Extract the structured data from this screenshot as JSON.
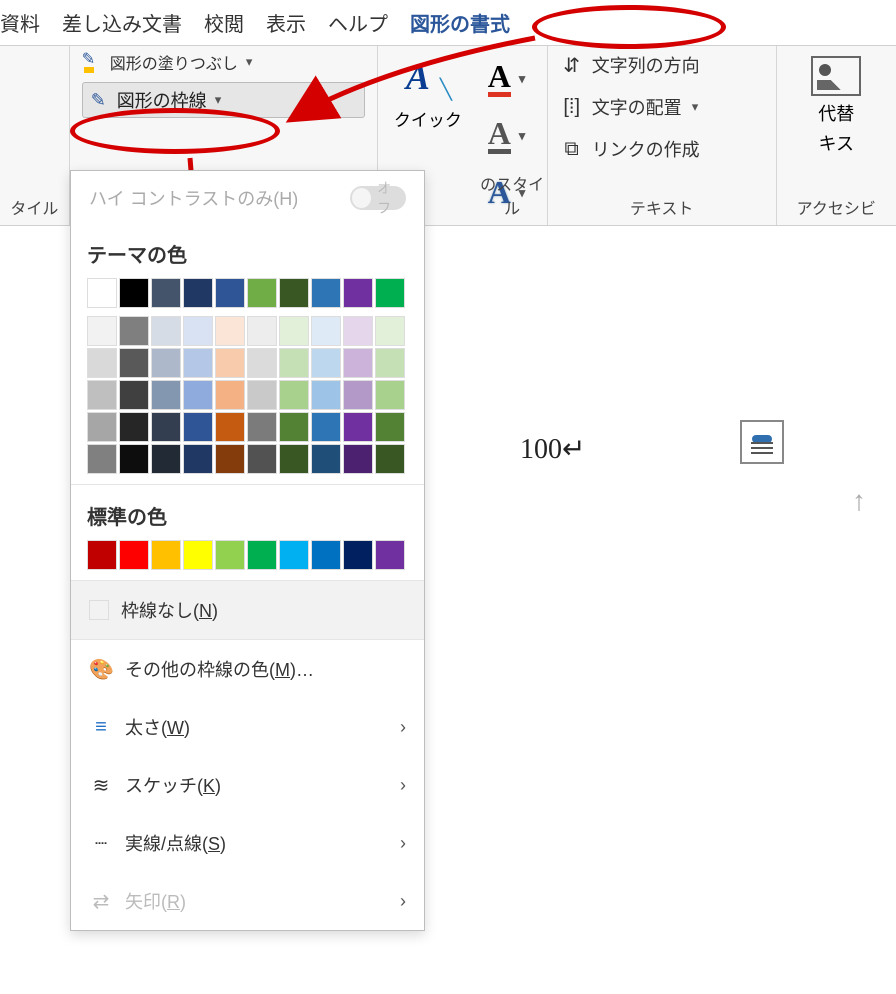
{
  "tabs": {
    "references": "資料",
    "mailings": "差し込み文書",
    "review": "校閲",
    "view": "表示",
    "help": "ヘルプ",
    "shape_format": "図形の書式"
  },
  "ribbon": {
    "shape_fill_label": "図形の塗りつぶし",
    "shape_outline_label": "図形の枠線",
    "styles_group_label": "タイル",
    "quick_label": "クイック",
    "wordart_group_label": "のスタイル",
    "text_direction_label": "文字列の方向",
    "text_align_label": "文字の配置",
    "create_link_label": "リンクの作成",
    "text_group_label": "テキスト",
    "alt_text_l1": "代替",
    "alt_text_l2": "キス",
    "access_group_label": "アクセシビ"
  },
  "popup": {
    "high_contrast_label": "ハイ コントラストのみ(H)",
    "high_contrast_toggle": "オフ",
    "theme_colors_title": "テーマの色",
    "standard_colors_title": "標準の色",
    "no_outline_label": "枠線なし(N)",
    "more_colors_label": "その他の枠線の色(M)…",
    "weight_label": "太さ(W)",
    "sketch_label": "スケッチ(K)",
    "dashes_label": "実線/点線(S)",
    "arrows_label": "矢印(R)",
    "theme_row1": [
      "#ffffff",
      "#000000",
      "#44546a",
      "#1f3864",
      "#2f5597",
      "#70ad47",
      "#385723",
      "#2e75b6",
      "#7030a0",
      "#00b050"
    ],
    "shades": [
      [
        "#f2f2f2",
        "#7f7f7f",
        "#d6dce5",
        "#d9e2f3",
        "#fbe5d6",
        "#ededed",
        "#e2f0d9",
        "#deebf7",
        "#e5d6ec",
        "#e2f0d9"
      ],
      [
        "#d9d9d9",
        "#595959",
        "#adb9ca",
        "#b4c7e7",
        "#f8cbad",
        "#dbdbdb",
        "#c5e0b4",
        "#bdd7ee",
        "#ccb3da",
        "#c5e0b4"
      ],
      [
        "#bfbfbf",
        "#404040",
        "#8497b0",
        "#8faadc",
        "#f4b183",
        "#c9c9c9",
        "#a9d18e",
        "#9dc3e6",
        "#b399c8",
        "#a9d18e"
      ],
      [
        "#a6a6a6",
        "#262626",
        "#333f50",
        "#2f5597",
        "#c55a11",
        "#7b7b7b",
        "#548235",
        "#2e75b6",
        "#7030a0",
        "#548235"
      ],
      [
        "#808080",
        "#0d0d0d",
        "#222a35",
        "#1f3864",
        "#843c0c",
        "#525252",
        "#385723",
        "#1f4e79",
        "#4c2270",
        "#385723"
      ]
    ],
    "standard": [
      "#c00000",
      "#ff0000",
      "#ffc000",
      "#ffff00",
      "#92d050",
      "#00b050",
      "#00b0f0",
      "#0070c0",
      "#002060",
      "#7030a0"
    ]
  },
  "doc": {
    "text": "100↵"
  }
}
